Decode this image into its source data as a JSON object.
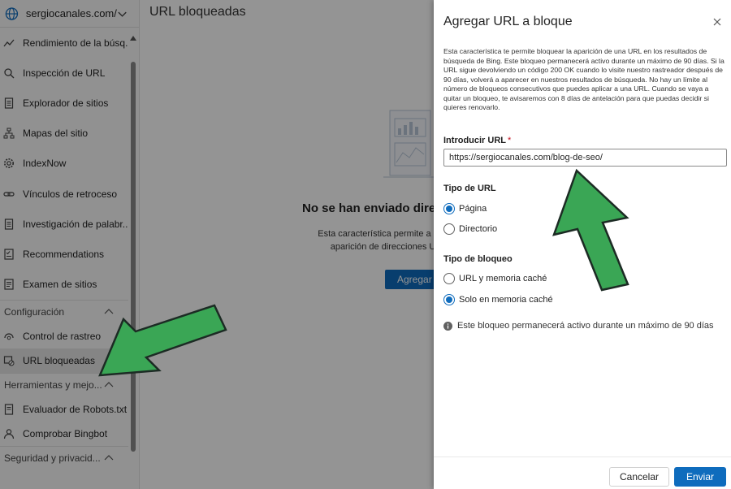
{
  "sidebar": {
    "site_name": "sergiocanales.com/",
    "items": [
      {
        "label": "Rendimiento de la búsq...",
        "icon": "trend-icon"
      },
      {
        "label": "Inspección de URL",
        "icon": "search-icon"
      },
      {
        "label": "Explorador de sitios",
        "icon": "document-icon"
      },
      {
        "label": "Mapas del sitio",
        "icon": "sitemap-icon"
      },
      {
        "label": "IndexNow",
        "icon": "gear-icon"
      },
      {
        "label": "Vínculos de retroceso",
        "icon": "link-icon"
      },
      {
        "label": "Investigación de palabr...",
        "icon": "document-icon"
      },
      {
        "label": "Recommendations",
        "icon": "checklist-icon"
      },
      {
        "label": "Examen de sitios",
        "icon": "report-icon"
      }
    ],
    "sections": [
      {
        "label": "Configuración",
        "items": [
          {
            "label": "Control de rastreo",
            "icon": "crawl-icon"
          },
          {
            "label": "URL bloqueadas",
            "icon": "block-icon"
          }
        ]
      },
      {
        "label": "Herramientas y mejo...",
        "items": [
          {
            "label": "Evaluador de Robots.txt",
            "icon": "document-icon"
          },
          {
            "label": "Comprobar Bingbot",
            "icon": "person-icon"
          }
        ]
      },
      {
        "label": "Seguridad y privacid...",
        "items": []
      }
    ]
  },
  "main": {
    "title": "URL bloqueadas",
    "empty_title": "No se han enviado direcc",
    "empty_text_line1": "Esta característica permite a los admin",
    "empty_text_line2": "aparición de direcciones URL en",
    "add_button": "Agregar U"
  },
  "panel": {
    "title": "Agregar URL a bloque",
    "description": "Esta característica te permite bloquear la aparición de una URL en los resultados de búsqueda de Bing. Este bloqueo permanecerá activo durante un máximo de 90 días. Si la URL sigue devolviendo un código 200 OK cuando lo visite nuestro rastreador después de 90 días, volverá a aparecer en nuestros resultados de búsqueda. No hay un límite al número de bloqueos consecutivos que puedes aplicar a una URL. Cuando se vaya a quitar un bloqueo, te avisaremos con 8 días de antelación para que puedas decidir si quieres renovarlo.",
    "url_label": "Introducir URL",
    "url_required": "*",
    "url_value": "https://sergiocanales.com/blog-de-seo/",
    "url_type_label": "Tipo de URL",
    "url_type_options": [
      "Página",
      "Directorio"
    ],
    "url_type_selected": "Página",
    "block_type_label": "Tipo de bloqueo",
    "block_type_options": [
      "URL y memoria caché",
      "Solo en memoria caché"
    ],
    "block_type_selected": "Solo en memoria caché",
    "info_text": "Este bloqueo permanecerá activo durante un máximo de 90 días",
    "cancel_label": "Cancelar",
    "submit_label": "Enviar"
  },
  "colors": {
    "accent": "#0f6cbd",
    "arrow_fill": "#3aa655",
    "arrow_stroke": "#1c2b24"
  }
}
